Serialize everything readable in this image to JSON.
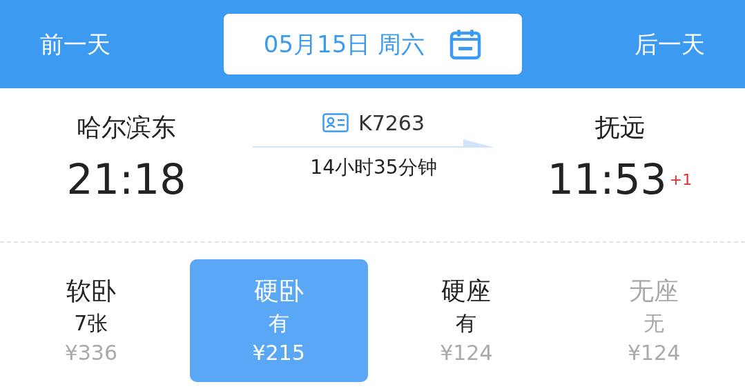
{
  "nav": {
    "prev_day": "前一天",
    "date": "05月15日 周六",
    "next_day": "后一天"
  },
  "train": {
    "from_station": "哈尔滨东",
    "depart_time": "21:18",
    "number": "K7263",
    "duration": "14小时35分钟",
    "to_station": "抚远",
    "arrive_time": "11:53",
    "day_offset": "+1"
  },
  "seats": [
    {
      "name": "软卧",
      "availability": "7张",
      "price": "¥336",
      "selected": false,
      "disabled": false
    },
    {
      "name": "硬卧",
      "availability": "有",
      "price": "¥215",
      "selected": true,
      "disabled": false
    },
    {
      "name": "硬座",
      "availability": "有",
      "price": "¥124",
      "selected": false,
      "disabled": false
    },
    {
      "name": "无座",
      "availability": "无",
      "price": "¥124",
      "selected": false,
      "disabled": true
    }
  ]
}
